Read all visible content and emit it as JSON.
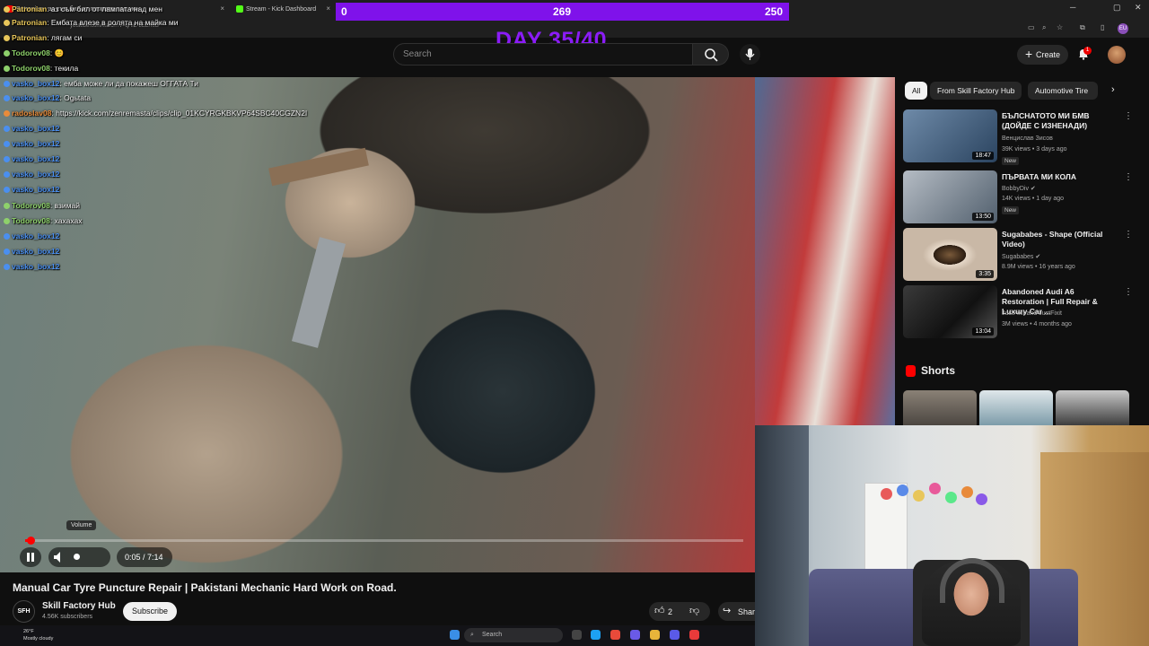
{
  "browser": {
    "tabs": [
      {
        "label": "Patronian : аз съм бил от лампата над мен",
        "close": "×"
      },
      {
        "label": "Stream - Kick Dashboard",
        "close": "×"
      }
    ],
    "url": "youtube.com/watch?v=qHiE-bELR6B"
  },
  "stream_overlay": {
    "left_value": "0",
    "center_value": "269",
    "right_value": "250",
    "day_text": "DAY 35/40"
  },
  "chat": [
    {
      "user": "Patronian",
      "message": ": аз съм бил от лампата над мен",
      "color": "#e8c65a"
    },
    {
      "user": "Patronian",
      "message": ": Ембата влезе в ролята на майка ми",
      "color": "#e8c65a"
    },
    {
      "user": "Patronian",
      "message": ": лягам си",
      "color": "#e8c65a"
    },
    {
      "user": "Todorov08",
      "message": ": 😊",
      "color": "#8ed16b"
    },
    {
      "user": "Todorov08",
      "message": ": текила",
      "color": "#8ed16b"
    },
    {
      "user": "vasko_box12",
      "message": ": емба може ли да покажеш ОГГАТА Ти",
      "color": "#4a8ff0"
    },
    {
      "user": "vasko_box12",
      "message": ": Ogьtata",
      "color": "#4a8ff0"
    },
    {
      "user": "radoslav08",
      "message": ": https://kick.com/zenremasta/clips/clip_01KCYRGKBKVP64SBC40CGZN2I",
      "color": "#e88b3a"
    },
    {
      "user": "vasko_box12",
      "message": "",
      "color": "#4a8ff0"
    },
    {
      "user": "vasko_box12",
      "message": "",
      "color": "#4a8ff0"
    },
    {
      "user": "vasko_box12",
      "message": "",
      "color": "#4a8ff0"
    },
    {
      "user": "vasko_box12",
      "message": "",
      "color": "#4a8ff0"
    },
    {
      "user": "vasko_box12",
      "message": "",
      "color": "#4a8ff0"
    },
    {
      "user": "Todorov08",
      "message": ": взимай",
      "color": "#8ed16b"
    },
    {
      "user": "Todorov08",
      "message": ": хахахах",
      "color": "#8ed16b"
    },
    {
      "user": "vasko_box12",
      "message": "",
      "color": "#4a8ff0"
    },
    {
      "user": "vasko_box12",
      "message": "",
      "color": "#4a8ff0"
    },
    {
      "user": "vasko_box12",
      "message": "",
      "color": "#4a8ff0"
    }
  ],
  "header": {
    "search_placeholder": "Search",
    "create_label": "Create",
    "notification_count": "1"
  },
  "player": {
    "tooltip": "Volume",
    "time": "0:05 / 7:14",
    "progress": 0.012
  },
  "video": {
    "title": "Manual Car Tyre Puncture Repair | Pakistani Mechanic Hard Work on Road.",
    "channel": "Skill Factory Hub",
    "channel_initials": "SFH",
    "subscribers": "4.56K subscribers",
    "subscribe_label": "Subscribe",
    "likes": "2",
    "share_label": "Shar"
  },
  "sidebar": {
    "chips": [
      "All",
      "From Skill Factory Hub",
      "Automotive Tire"
    ],
    "recommendations": [
      {
        "title": "БЪЛСНАТОТО МИ БМВ (ДОЙДЕ С ИЗНЕНАДИ)",
        "channel": "Венцислав Зисов",
        "meta": "39K views • 3 days ago",
        "badge": "New",
        "duration": "18:47"
      },
      {
        "title": "ПЪРВАТА МИ КОЛА",
        "channel": "BobbyDiv ✔",
        "meta": "14K views • 1 day ago",
        "badge": "New",
        "duration": "13:50"
      },
      {
        "title": "Sugababes - Shape (Official Video)",
        "channel": "Sugababes ✔",
        "meta": "8.9M views • 16 years ago",
        "badge": "",
        "duration": "3:35"
      },
      {
        "title": "Abandoned Audi A6 Restoration | Full Repair & Luxury Car ...",
        "channel": "JustFixit and JustFixit",
        "meta": "3M views • 4 months ago",
        "badge": "",
        "duration": "13:04"
      }
    ],
    "shorts_label": "Shorts"
  },
  "taskbar": {
    "weather_temp": "26°F",
    "weather_desc": "Mostly cloudy",
    "search_label": "Search"
  }
}
